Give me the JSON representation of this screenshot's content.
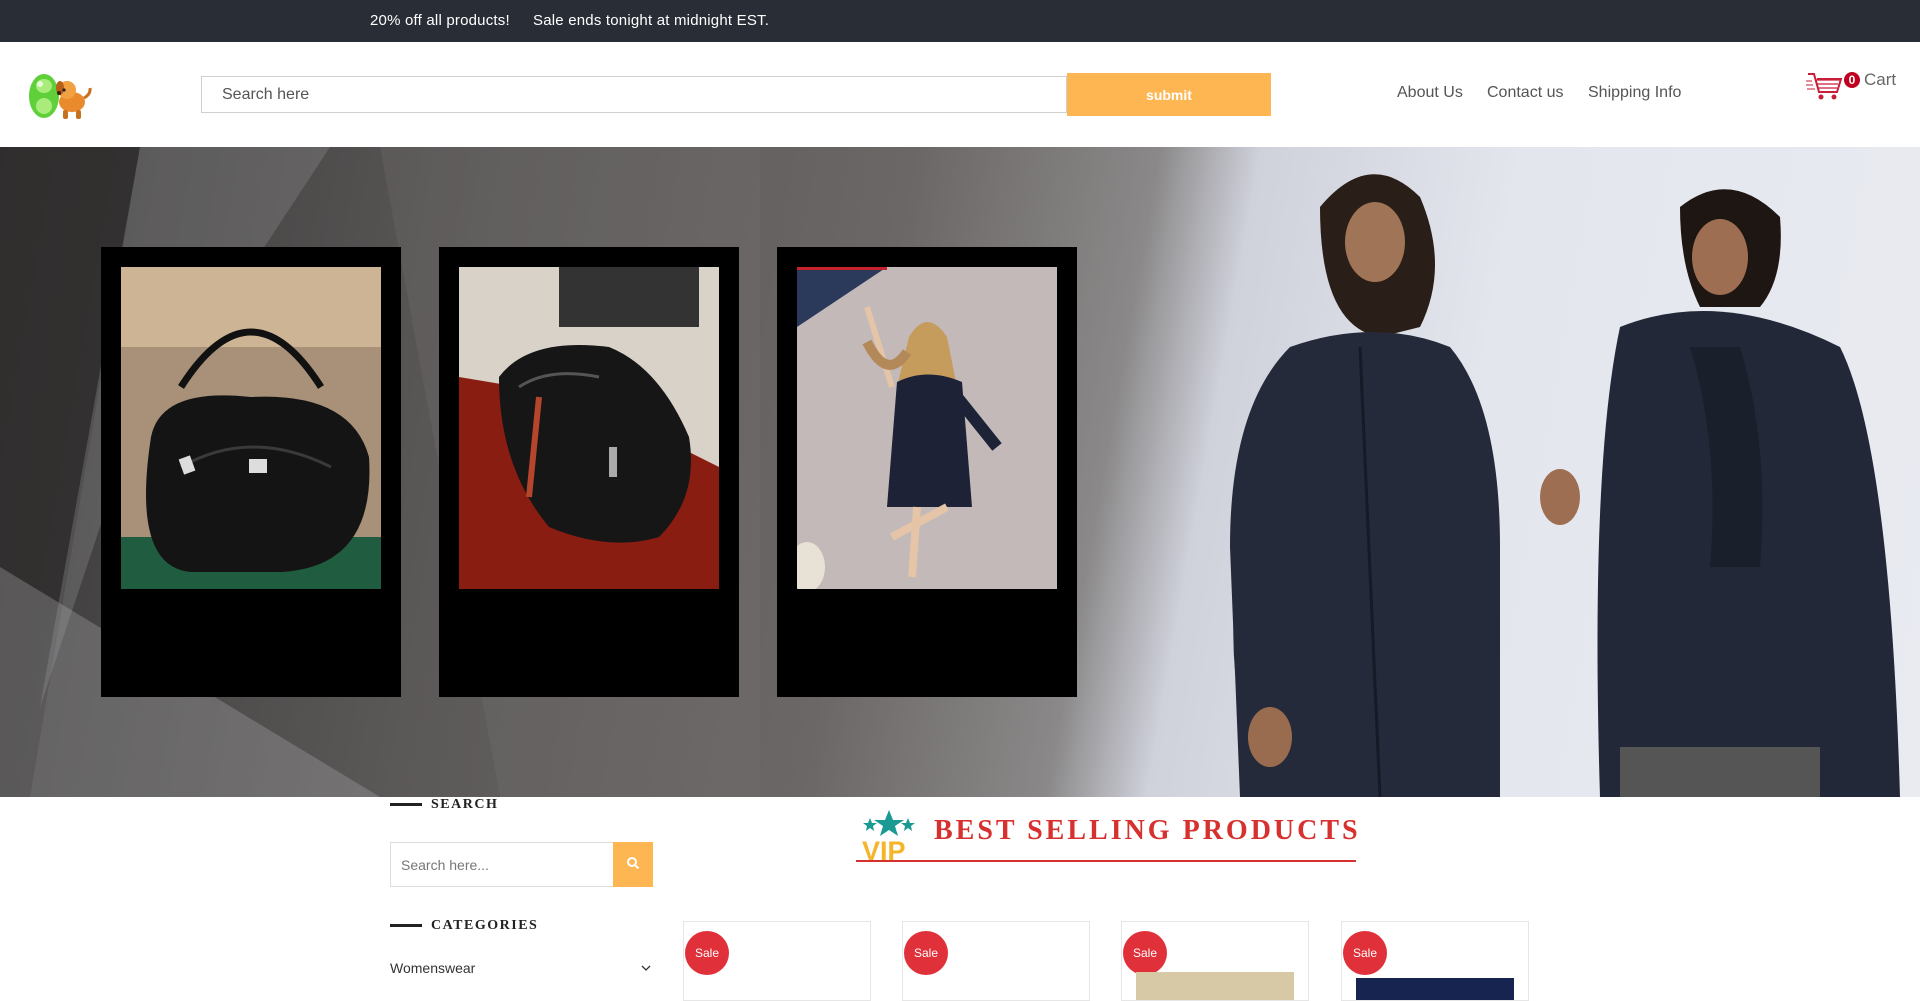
{
  "announcement": {
    "part1": "20% off all products!",
    "part2": "Sale ends tonight at midnight EST."
  },
  "header": {
    "logo_icon": "toy-dog-logo-icon",
    "search_placeholder": "Search here",
    "submit_label": "submit",
    "nav": [
      {
        "label": "About Us"
      },
      {
        "label": "Contact us"
      },
      {
        "label": "Shipping Info"
      }
    ],
    "cart": {
      "count": "0",
      "label": "Cart",
      "icon": "shopping-cart-icon"
    }
  },
  "hero": {
    "cards": [
      {
        "subject": "black leather handbag"
      },
      {
        "subject": "black leather sneaker"
      },
      {
        "subject": "woman in patent leather dress"
      }
    ]
  },
  "sidebar": {
    "search_heading": "SEARCH",
    "search_placeholder": "Search here...",
    "categories_heading": "CATEGORIES",
    "categories": [
      {
        "label": "Womenswear"
      }
    ]
  },
  "best_selling": {
    "title": "BEST SELLING PRODUCTS",
    "badge_icon": "vip-star-icon",
    "products": [
      {
        "badge": "Sale"
      },
      {
        "badge": "Sale"
      },
      {
        "badge": "Sale"
      },
      {
        "badge": "Sale"
      }
    ]
  },
  "colors": {
    "announcement_bg": "#282d36",
    "accent_orange": "#fdb652",
    "heading_red": "#d7312f",
    "sale_red": "#e0303a"
  }
}
